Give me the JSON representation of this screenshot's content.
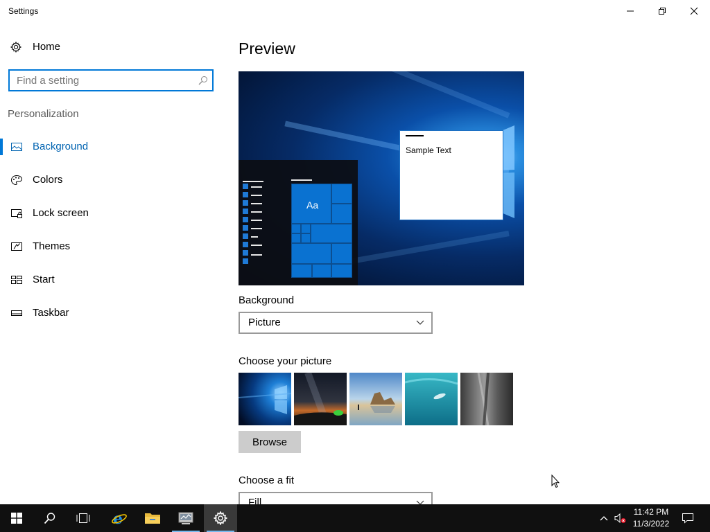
{
  "window": {
    "title": "Settings",
    "minimize_icon": "minimize-icon",
    "restore_icon": "restore-icon",
    "close_icon": "close-icon"
  },
  "sidebar": {
    "home_label": "Home",
    "search_placeholder": "Find a setting",
    "section_title": "Personalization",
    "items": [
      {
        "label": "Background",
        "icon": "picture-icon",
        "active": true
      },
      {
        "label": "Colors",
        "icon": "palette-icon",
        "active": false
      },
      {
        "label": "Lock screen",
        "icon": "lock-screen-icon",
        "active": false
      },
      {
        "label": "Themes",
        "icon": "themes-icon",
        "active": false
      },
      {
        "label": "Start",
        "icon": "start-icon",
        "active": false
      },
      {
        "label": "Taskbar",
        "icon": "taskbar-icon",
        "active": false
      }
    ]
  },
  "main": {
    "heading": "Preview",
    "preview": {
      "tile_text": "Aa",
      "sample_text": "Sample Text"
    },
    "background_label": "Background",
    "background_value": "Picture",
    "choose_picture_label": "Choose your picture",
    "browse_label": "Browse",
    "choose_fit_label": "Choose a fit",
    "fit_value": "Fill"
  },
  "taskbar": {
    "time": "11:42 PM",
    "date": "11/3/2022"
  },
  "colors": {
    "accent": "#0078d7",
    "active_text": "#0063b1",
    "taskbar_bg": "#101010"
  }
}
